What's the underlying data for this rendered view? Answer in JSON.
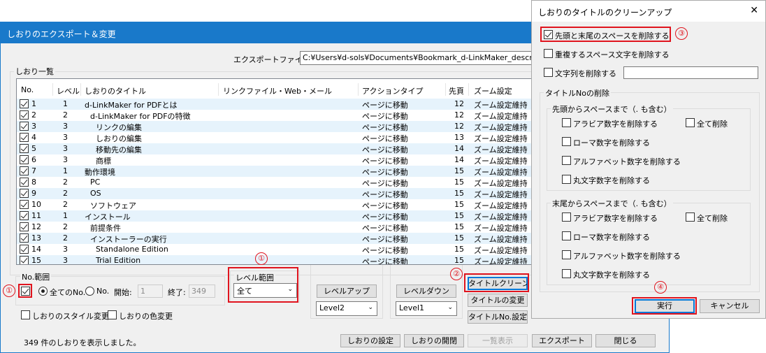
{
  "main_window": {
    "title": "しおりのエクスポート＆変更",
    "export_file_label": "エクスポートファイル:",
    "export_file_value": "C:¥Users¥d-sols¥Documents¥Bookmark_d-LinkMaker_description",
    "list_group_label": "しおり一覧",
    "columns": [
      "No.",
      "レベル",
      "しおりのタイトル",
      "リンクファイル・Web・メール",
      "アクションタイプ",
      "先頁",
      "ズーム設定"
    ],
    "rows": [
      {
        "no": "1",
        "level": "1",
        "title": "d-LinkMaker for PDFとは",
        "link": "",
        "action": "ページに移動",
        "page": "12",
        "zoom": "ズーム設定維持"
      },
      {
        "no": "2",
        "level": "2",
        "title": "d-LinkMaker for PDFの特徴",
        "link": "",
        "action": "ページに移動",
        "page": "12",
        "zoom": "ズーム設定維持"
      },
      {
        "no": "3",
        "level": "3",
        "title": "リンクの編集",
        "link": "",
        "action": "ページに移動",
        "page": "12",
        "zoom": "ズーム設定維持"
      },
      {
        "no": "4",
        "level": "3",
        "title": "しおりの編集",
        "link": "",
        "action": "ページに移動",
        "page": "13",
        "zoom": "ズーム設定維持"
      },
      {
        "no": "5",
        "level": "3",
        "title": "移動先の編集",
        "link": "",
        "action": "ページに移動",
        "page": "14",
        "zoom": "ズーム設定維持"
      },
      {
        "no": "6",
        "level": "3",
        "title": "商標",
        "link": "",
        "action": "ページに移動",
        "page": "14",
        "zoom": "ズーム設定維持"
      },
      {
        "no": "7",
        "level": "1",
        "title": "動作環境",
        "link": "",
        "action": "ページに移動",
        "page": "15",
        "zoom": "ズーム設定維持"
      },
      {
        "no": "8",
        "level": "2",
        "title": "PC",
        "link": "",
        "action": "ページに移動",
        "page": "15",
        "zoom": "ズーム設定維持"
      },
      {
        "no": "9",
        "level": "2",
        "title": "OS",
        "link": "",
        "action": "ページに移動",
        "page": "15",
        "zoom": "ズーム設定維持"
      },
      {
        "no": "10",
        "level": "2",
        "title": "ソフトウェア",
        "link": "",
        "action": "ページに移動",
        "page": "15",
        "zoom": "ズーム設定維持"
      },
      {
        "no": "11",
        "level": "1",
        "title": "インストール",
        "link": "",
        "action": "ページに移動",
        "page": "15",
        "zoom": "ズーム設定維持"
      },
      {
        "no": "12",
        "level": "2",
        "title": "前提条件",
        "link": "",
        "action": "ページに移動",
        "page": "15",
        "zoom": "ズーム設定維持"
      },
      {
        "no": "13",
        "level": "2",
        "title": "インストーラーの実行",
        "link": "",
        "action": "ページに移動",
        "page": "15",
        "zoom": "ズーム設定維持"
      },
      {
        "no": "14",
        "level": "3",
        "title": "Standalone Edition",
        "link": "",
        "action": "ページに移動",
        "page": "15",
        "zoom": "ズーム設定維持"
      },
      {
        "no": "15",
        "level": "3",
        "title": "Trial Edition",
        "link": "",
        "action": "ページに移動",
        "page": "15",
        "zoom": "ズーム設定維持"
      }
    ],
    "no_range": {
      "label": "No.範囲",
      "all_label": "全てのNo.",
      "no_label": "No.",
      "start_label": "開始:",
      "start_value": "1",
      "end_label": "終了:",
      "end_value": "349"
    },
    "level_range": {
      "label": "レベル範囲",
      "value": "全て"
    },
    "level_up_button": "レベルアップ",
    "level_up_select": "Level2",
    "level_down_button": "レベルダウン",
    "level_down_select": "Level1",
    "title_clean_button": "タイトルクリーン",
    "title_change_button": "タイトルの変更",
    "title_no_button": "タイトルNo.設定",
    "style_change_label": "しおりのスタイル変更",
    "color_change_label": "しおりの色変更",
    "status_text": "349 件のしおりを表示しました。",
    "bottom_buttons": {
      "settings": "しおりの設定",
      "open_close": "しおりの開閉",
      "list_view": "一覧表示",
      "export": "エクスポート",
      "close": "閉じる"
    }
  },
  "dialog": {
    "title": "しおりのタイトルのクリーンアップ",
    "close_symbol": "✕",
    "opt_trim_spaces": "先頭と末尾のスペースを削除する",
    "opt_dup_spaces": "重複するスペース文字を削除する",
    "opt_remove_string": "文字列を削除する",
    "remove_string_value": "",
    "title_no_group": "タイトルNoの削除",
    "head_group": "先頭からスペースまで（. も含む）",
    "tail_group": "末尾からスペースまで（. も含む）",
    "opt_arabic": "アラビア数字を削除する",
    "opt_roman": "ローマ数字を削除する",
    "opt_alpha": "アルファベット数字を削除する",
    "opt_circled": "丸文字数字を削除する",
    "opt_all": "全て削除",
    "run_button": "実行",
    "cancel_button": "キャンセル"
  },
  "markers": [
    "①",
    "①",
    "②",
    "③",
    "④"
  ],
  "colors": {
    "accent": "#1979ca",
    "annotation": "#e0141e",
    "row_alt": "#e6f3fc"
  }
}
